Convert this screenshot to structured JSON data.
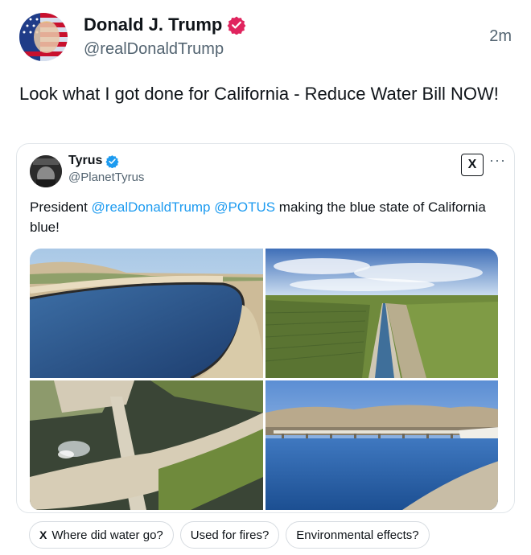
{
  "author": {
    "name": "Donald J. Trump",
    "handle": "@realDonaldTrump",
    "timestamp": "2m",
    "verified_color": "#e0245e"
  },
  "post": {
    "text": "Look what I got done for California - Reduce Water Bill NOW!"
  },
  "embedded": {
    "name": "Tyrus",
    "handle": "@PlanetTyrus",
    "verified_color": "#1d9bf0",
    "x_logo": "X",
    "more": "···",
    "text_before": "President ",
    "mention_1": "@realDonaldTrump",
    "mention_2": "@POTUS",
    "text_after": " making the blue state of California blue!",
    "photos": [
      {
        "icon": "canal-curve-photo"
      },
      {
        "icon": "aerial-canal-photo"
      },
      {
        "icon": "canal-bridge-photo"
      },
      {
        "icon": "reservoir-photo"
      }
    ]
  },
  "chips": [
    {
      "label": "Where did water go?",
      "icon": "x-logo-icon"
    },
    {
      "label": "Used for fires?"
    },
    {
      "label": "Environmental effects?"
    }
  ],
  "colors": {
    "mention": "#1d9bf0",
    "text": "#0f1419",
    "muted": "#536471"
  }
}
